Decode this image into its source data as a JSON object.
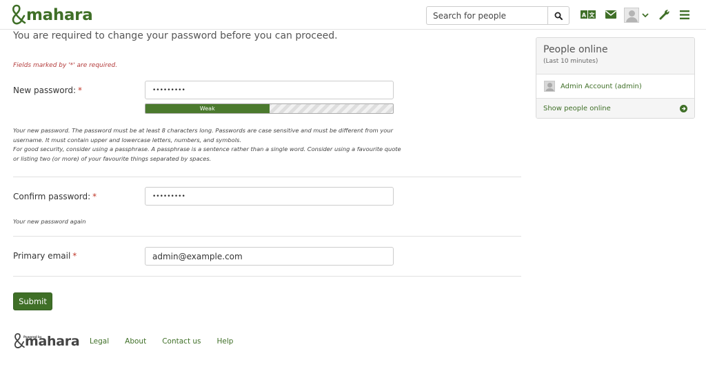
{
  "header": {
    "logo_text": "mahara",
    "search_placeholder": "Search for people",
    "icons": [
      "search-icon",
      "language-icon",
      "mail-icon",
      "user-avatar-icon",
      "chevron-down-icon",
      "wrench-icon",
      "menu-icon"
    ],
    "language_glyphs": "A文",
    "brand_color": "#3f6f27"
  },
  "main": {
    "lead": "You are required to change your password before you can proceed.",
    "required_note": "Fields marked by '*' are required.",
    "new_password": {
      "label": "New password:",
      "required_mark": "*",
      "value": "•••••••••",
      "strength_label": "Weak",
      "strength_fraction": 0.5,
      "description_lines": [
        "Your new password. The password must be at least 8 characters long. Passwords are case sensitive and must be different from your",
        "username. It must contain upper and lowercase letters, numbers, and symbols.",
        "For good security, consider using a passphrase. A passphrase is a sentence rather than a single word. Consider using a favourite quote",
        "or listing two (or more) of your favourite things separated by spaces."
      ]
    },
    "confirm_password": {
      "label": "Confirm password:",
      "required_mark": "*",
      "value": "•••••••••",
      "description": "Your new password again"
    },
    "primary_email": {
      "label": "Primary email",
      "required_mark": "*",
      "value": "admin@example.com"
    },
    "submit_label": "Submit"
  },
  "sidebar": {
    "title": "People online",
    "subtitle": "(Last 10 minutes)",
    "people": [
      "Admin Account (admin)"
    ],
    "show_link": "Show people online"
  },
  "footer": {
    "powered_by": "Powered by",
    "logo_text": "mahara",
    "links": [
      "Legal",
      "About",
      "Contact us",
      "Help"
    ]
  }
}
